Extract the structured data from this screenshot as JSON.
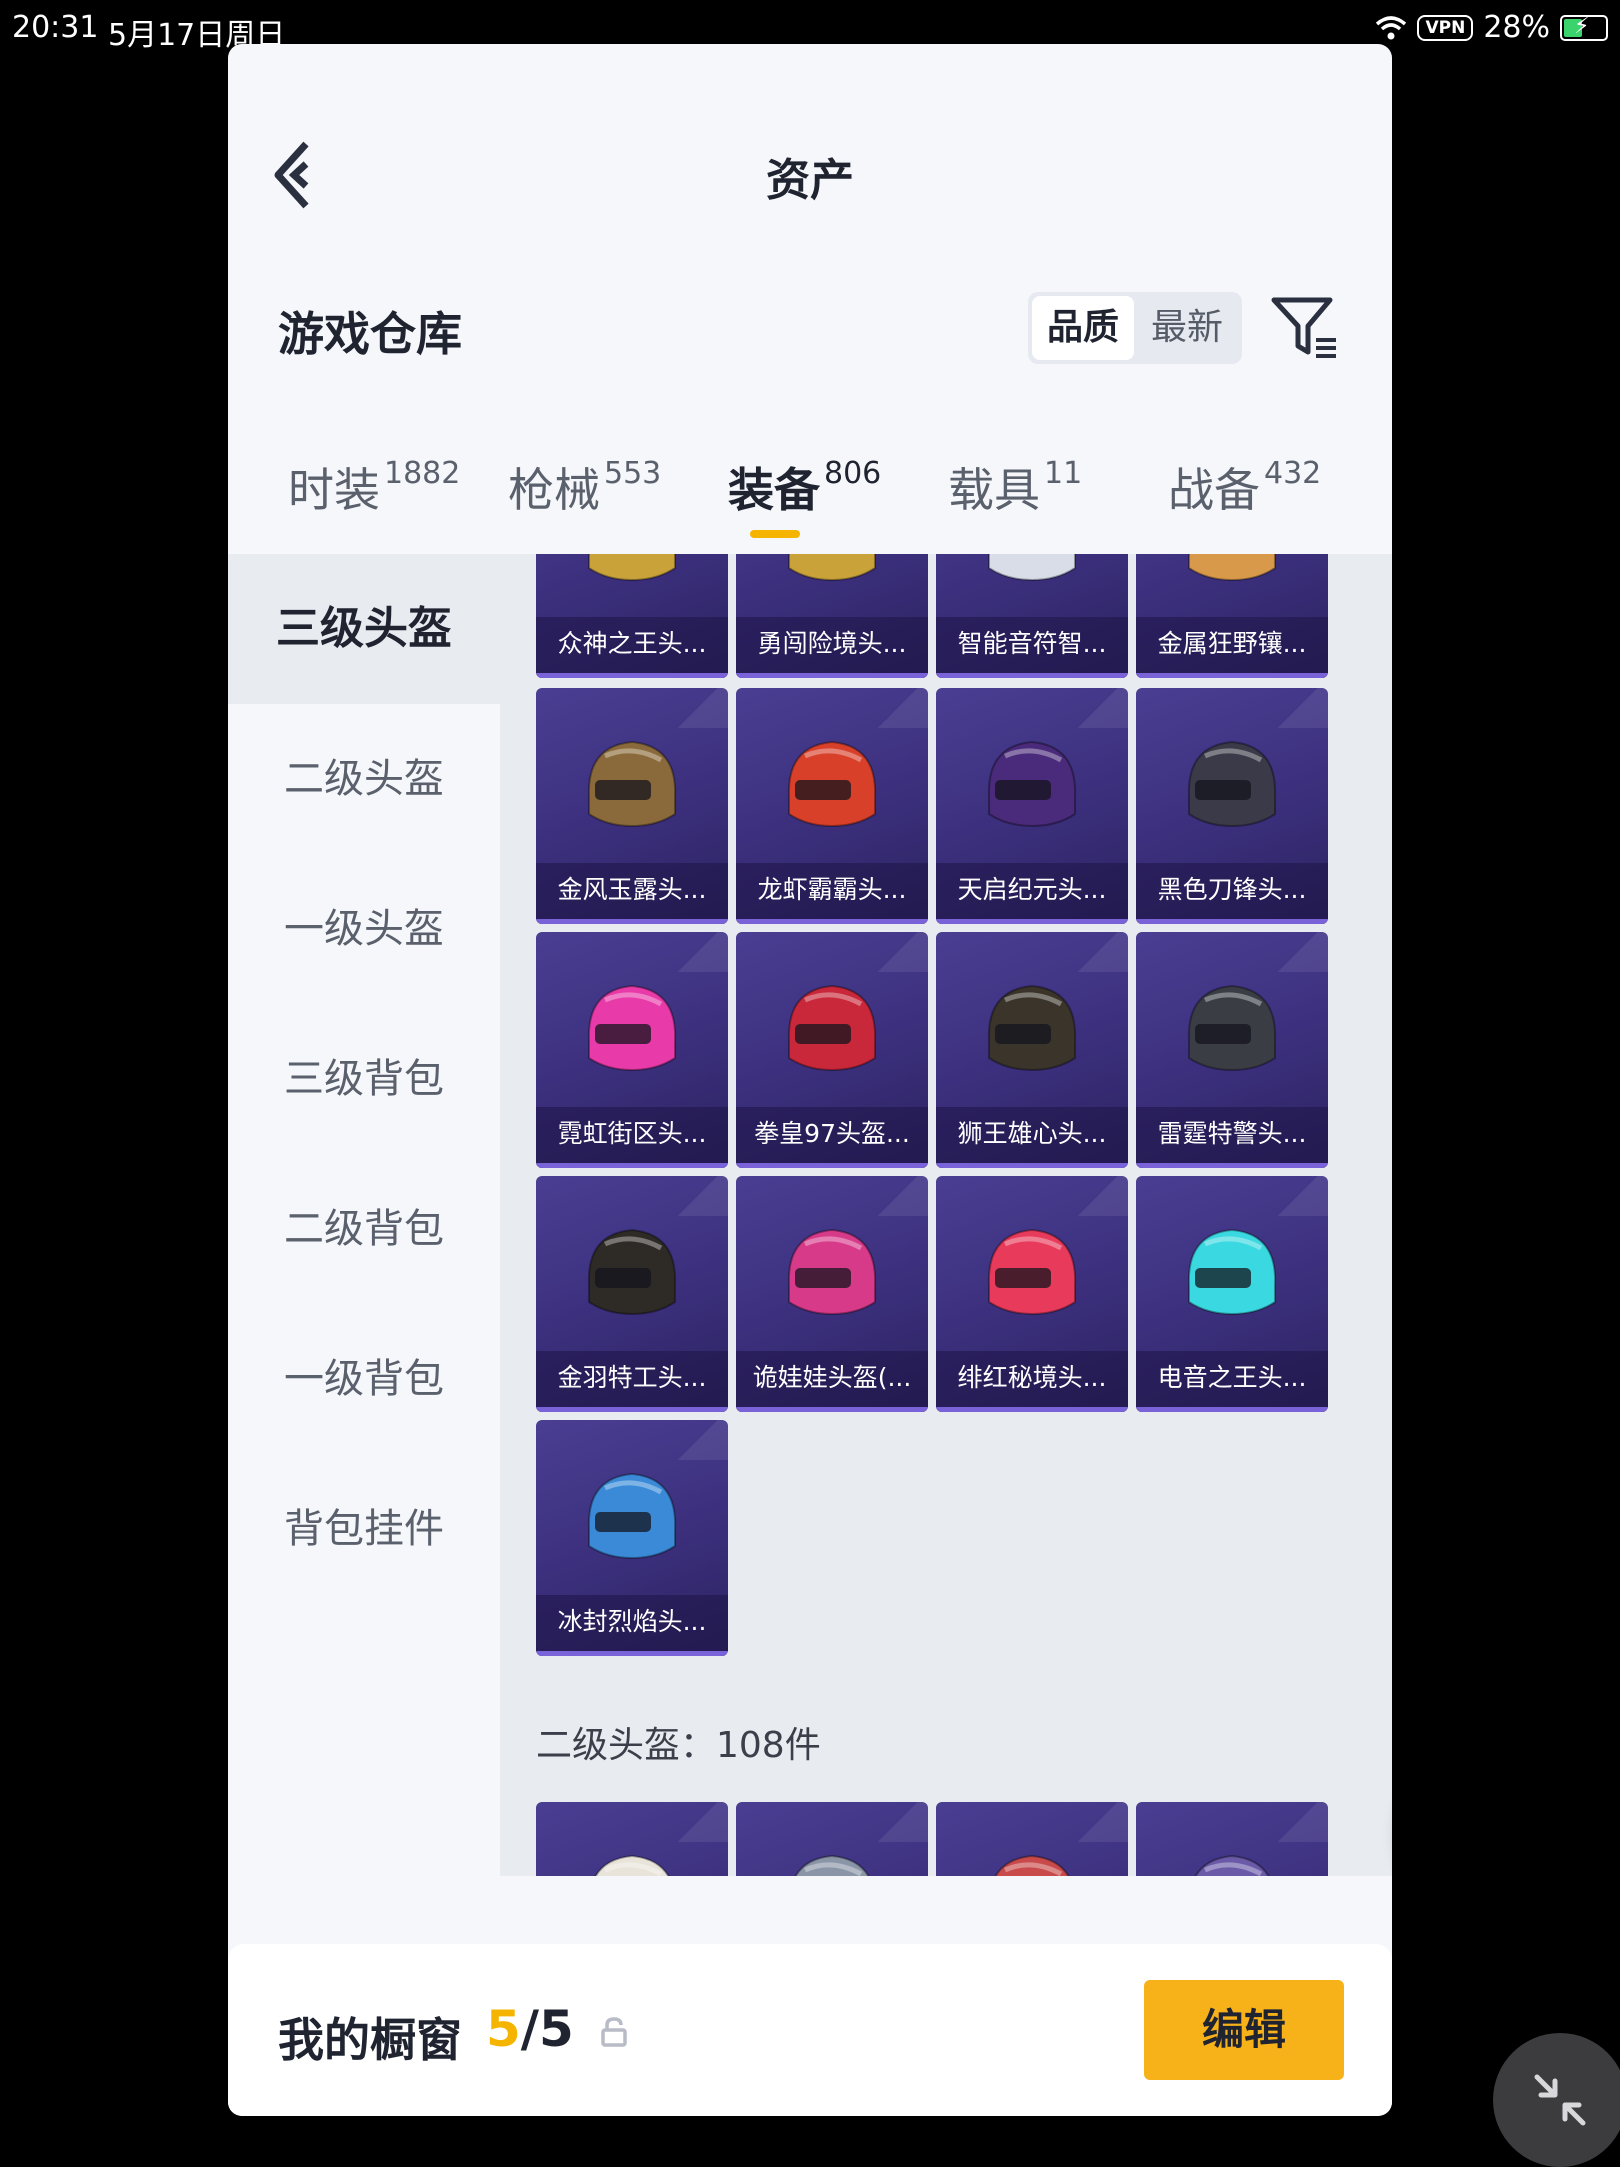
{
  "status_bar": {
    "time": "20:31",
    "date": "5月17日周日",
    "vpn": "VPN",
    "battery": "28%"
  },
  "header": {
    "title": "资产"
  },
  "section": {
    "title": "游戏仓库"
  },
  "sort": {
    "options": [
      "品质",
      "最新"
    ],
    "selected": "品质"
  },
  "tabs": [
    {
      "label": "时装",
      "count": "1882"
    },
    {
      "label": "枪械",
      "count": "553"
    },
    {
      "label": "装备",
      "count": "806"
    },
    {
      "label": "载具",
      "count": "11"
    },
    {
      "label": "战备",
      "count": "432"
    }
  ],
  "active_tab": "装备",
  "sidebar": {
    "items": [
      {
        "label": "三级头盔"
      },
      {
        "label": "二级头盔"
      },
      {
        "label": "一级头盔"
      },
      {
        "label": "三级背包"
      },
      {
        "label": "二级背包"
      },
      {
        "label": "一级背包"
      },
      {
        "label": "背包挂件"
      }
    ],
    "active": "三级头盔"
  },
  "items": {
    "row0": [
      {
        "name": "众神之王头...",
        "icon": "helmet-icon",
        "color": "#c9a23a"
      },
      {
        "name": "勇闯险境头...",
        "icon": "helmet-icon",
        "color": "#c9a23a"
      },
      {
        "name": "智能音符智...",
        "icon": "helmet-icon",
        "color": "#d8dde8"
      },
      {
        "name": "金属狂野镶...",
        "icon": "helmet-icon",
        "color": "#d89a4a"
      }
    ],
    "row1": [
      {
        "name": "金风玉露头...",
        "icon": "helmet-icon",
        "color": "#8a6a3a"
      },
      {
        "name": "龙虾霸霸头...",
        "icon": "helmet-icon",
        "color": "#d8402a"
      },
      {
        "name": "天启纪元头...",
        "icon": "helmet-icon",
        "color": "#4a2a7a"
      },
      {
        "name": "黑色刀锋头...",
        "icon": "helmet-icon",
        "color": "#3a3a48"
      }
    ],
    "row2": [
      {
        "name": "霓虹街区头...",
        "icon": "helmet-icon",
        "color": "#e83aa8"
      },
      {
        "name": "拳皇97头盔...",
        "icon": "helmet-icon",
        "color": "#c8283a"
      },
      {
        "name": "狮王雄心头...",
        "icon": "helmet-icon",
        "color": "#3a342a"
      },
      {
        "name": "雷霆特警头...",
        "icon": "helmet-icon",
        "color": "#3a3e44"
      }
    ],
    "row3": [
      {
        "name": "金羽特工头...",
        "icon": "helmet-icon",
        "color": "#2e2a26"
      },
      {
        "name": "诡娃娃头盔(...",
        "icon": "helmet-icon",
        "color": "#d83a8a"
      },
      {
        "name": "绯红秘境头...",
        "icon": "helmet-icon",
        "color": "#e83a5a"
      },
      {
        "name": "电音之王头...",
        "icon": "helmet-icon",
        "color": "#3ad8e0"
      }
    ],
    "row4": [
      {
        "name": "冰封烈焰头...",
        "icon": "helmet-icon",
        "color": "#3a8ad8"
      }
    ]
  },
  "sub_section": {
    "text": "二级头盔：108件"
  },
  "next_row_colors": [
    "#e8e4da",
    "#8a96a8",
    "#c84a4a",
    "#6a5aa8"
  ],
  "bottom": {
    "label": "我的橱窗",
    "current": "5",
    "total": "/5",
    "edit": "编辑"
  },
  "icons": {
    "fab": "share-export-icon",
    "lock": "lock-icon",
    "collapse": "collapse-icon",
    "filter": "filter-list-icon",
    "back": "back-arrow-icon"
  },
  "colors": {
    "accent": "#f7b21a",
    "card": "#3b2f7c",
    "card_edge": "#7a62d8"
  }
}
